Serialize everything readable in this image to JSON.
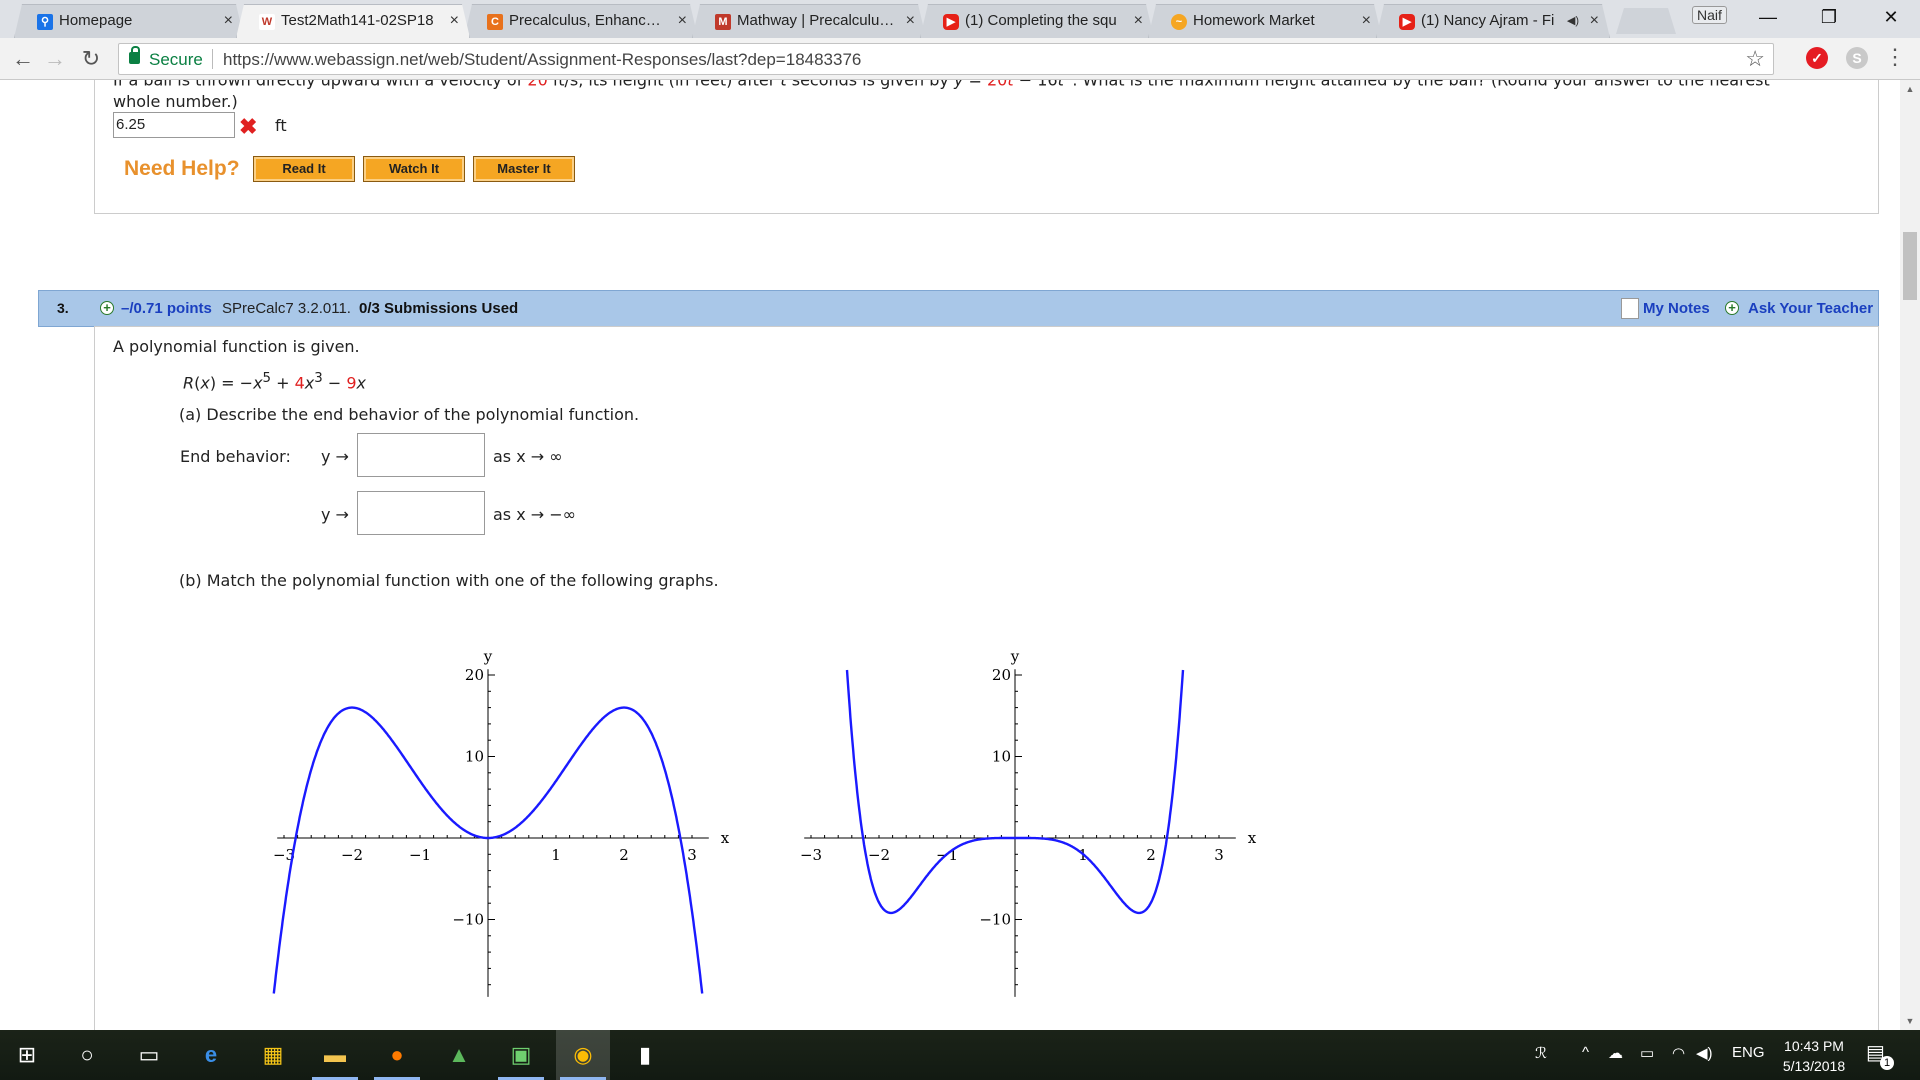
{
  "browser": {
    "tabs": [
      {
        "label": "Homepage",
        "icon": "search-icon",
        "color": "#1a73e8"
      },
      {
        "label": "Test2Math141-02SP18",
        "icon": "webassign-icon",
        "color": "#c0392b"
      },
      {
        "label": "Precalculus, Enhanced W",
        "icon": "cengage-icon",
        "color": "#e8711c"
      },
      {
        "label": "Mathway | Precalculus P",
        "icon": "mathway-icon",
        "color": "#c0392b"
      },
      {
        "label": "(1) Completing the squ",
        "icon": "youtube-icon",
        "color": "#e62117"
      },
      {
        "label": "Homework Market",
        "icon": "homeworkmarket-icon",
        "color": "#f5a623"
      },
      {
        "label": "(1) Nancy Ajram - Fi",
        "icon": "youtube-icon",
        "color": "#e62117"
      }
    ],
    "profile_name": "Naif",
    "secure_label": "Secure",
    "url": "https://www.webassign.net/web/Student/Assignment-Responses/last?dep=18483376"
  },
  "q2": {
    "line1_a": "If a ball is thrown directly upward with a velocity of ",
    "velocity": "20",
    "line1_b": " ft/s, its height (in feet) after ",
    "t_var": "t",
    "line1_c": " seconds is given by ",
    "eq_lhs": "y",
    "eq_eq": " = ",
    "eq_coef": "20",
    "eq_t": "t",
    "eq_rest": " − 16",
    "eq_t2": "t",
    "eq_exp": "2",
    "line1_d": ". What is the maximum height attained by the ball? (Round your answer to the nearest",
    "line2": "whole number.)",
    "answer": "6.25",
    "unit": "ft",
    "need_help": "Need Help?",
    "buttons": [
      "Read It",
      "Watch It",
      "Master It"
    ]
  },
  "q3": {
    "number": "3.",
    "points": "–/0.71 points",
    "code": "SPreCalc7 3.2.011.",
    "submissions": "0/3 Submissions Used",
    "my_notes": "My Notes",
    "ask_teacher": "Ask Your Teacher",
    "intro": "A polynomial function is given.",
    "func_name": "R",
    "func_var": "x",
    "func_a": ") = −",
    "func_b": " + ",
    "func_c1": "4",
    "func_c2": " − ",
    "func_c3": "9",
    "exp5": "5",
    "exp3": "3",
    "part_a": "(a) Describe the end behavior of the polynomial function.",
    "end_behavior": "End behavior:",
    "y_arrow": "y →",
    "as_x_inf": "as x → ∞",
    "as_x_neginf": "as x → −∞",
    "part_b": "(b) Match the polynomial function with one of the following graphs."
  },
  "graphs": [
    {
      "curve": "-x^4 + 8x^2",
      "xlabel": "x",
      "ylabel": "y",
      "xticks": [
        "−3",
        "−2",
        "−1",
        "1",
        "2",
        "3"
      ],
      "yticks": [
        "20",
        "10",
        "−10"
      ],
      "xlim": [
        -3.1,
        3.1
      ],
      "ylim": [
        -19,
        20
      ],
      "color": "#1a1aff"
    },
    {
      "curve": "x^5 - 2x^3 ... (sextic-like W shape with flat center)",
      "xlabel": "x",
      "ylabel": "y",
      "xticks": [
        "−3",
        "−2",
        "−1",
        "1",
        "2",
        "3"
      ],
      "yticks": [
        "20",
        "10",
        "−10"
      ],
      "xlim": [
        -3.1,
        3.1
      ],
      "ylim": [
        -19,
        20
      ],
      "color": "#1a1aff"
    }
  ],
  "taskbar": {
    "items": [
      "start-icon",
      "search-icon",
      "task-view-icon",
      "edge-icon",
      "store-icon",
      "file-explorer-icon",
      "firefox-icon",
      "camera-app-icon",
      "notes-app-icon",
      "chrome-icon",
      "file-icon"
    ],
    "lang": "ENG",
    "time": "10:43 PM",
    "date": "5/13/2018",
    "notif_count": "1"
  }
}
